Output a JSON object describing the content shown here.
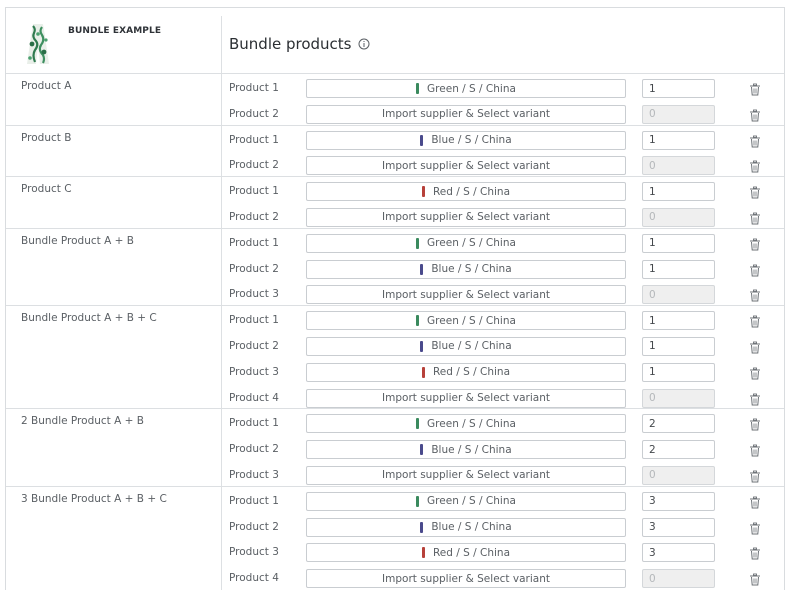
{
  "header": {
    "bundle_example": "BUNDLE EXAMPLE",
    "title": "Bundle products",
    "info_icon": "info-icon"
  },
  "colors": {
    "green": "#3a8a5e",
    "blue": "#4a4a8c",
    "red": "#b7413a",
    "border": "#c9cdd1"
  },
  "bundles": [
    {
      "name": "Product A",
      "rows": [
        {
          "label": "Product 1",
          "variant": "Green / S / China",
          "swatch": "green",
          "qty": "1",
          "disabled": false
        },
        {
          "label": "Product 2",
          "variant": "Import supplier & Select variant",
          "swatch": "",
          "qty": "0",
          "disabled": true
        }
      ]
    },
    {
      "name": "Product B",
      "rows": [
        {
          "label": "Product 1",
          "variant": "Blue / S / China",
          "swatch": "blue",
          "qty": "1",
          "disabled": false
        },
        {
          "label": "Product 2",
          "variant": "Import supplier & Select variant",
          "swatch": "",
          "qty": "0",
          "disabled": true
        }
      ]
    },
    {
      "name": "Product C",
      "rows": [
        {
          "label": "Product 1",
          "variant": "Red / S / China",
          "swatch": "red",
          "qty": "1",
          "disabled": false
        },
        {
          "label": "Product 2",
          "variant": "Import supplier & Select variant",
          "swatch": "",
          "qty": "0",
          "disabled": true
        }
      ]
    },
    {
      "name": "Bundle Product A + B",
      "rows": [
        {
          "label": "Product 1",
          "variant": "Green / S / China",
          "swatch": "green",
          "qty": "1",
          "disabled": false
        },
        {
          "label": "Product 2",
          "variant": "Blue / S / China",
          "swatch": "blue",
          "qty": "1",
          "disabled": false
        },
        {
          "label": "Product 3",
          "variant": "Import supplier & Select variant",
          "swatch": "",
          "qty": "0",
          "disabled": true
        }
      ]
    },
    {
      "name": "Bundle Product A + B + C",
      "rows": [
        {
          "label": "Product 1",
          "variant": "Green / S / China",
          "swatch": "green",
          "qty": "1",
          "disabled": false
        },
        {
          "label": "Product 2",
          "variant": "Blue / S / China",
          "swatch": "blue",
          "qty": "1",
          "disabled": false
        },
        {
          "label": "Product 3",
          "variant": "Red / S / China",
          "swatch": "red",
          "qty": "1",
          "disabled": false
        },
        {
          "label": "Product 4",
          "variant": "Import supplier & Select variant",
          "swatch": "",
          "qty": "0",
          "disabled": true
        }
      ]
    },
    {
      "name": "2 Bundle Product A + B",
      "rows": [
        {
          "label": "Product 1",
          "variant": "Green / S / China",
          "swatch": "green",
          "qty": "2",
          "disabled": false
        },
        {
          "label": "Product 2",
          "variant": "Blue / S / China",
          "swatch": "blue",
          "qty": "2",
          "disabled": false
        },
        {
          "label": "Product 3",
          "variant": "Import supplier & Select variant",
          "swatch": "",
          "qty": "0",
          "disabled": true
        }
      ]
    },
    {
      "name": "3 Bundle Product A + B + C",
      "rows": [
        {
          "label": "Product 1",
          "variant": "Green / S / China",
          "swatch": "green",
          "qty": "3",
          "disabled": false
        },
        {
          "label": "Product 2",
          "variant": "Blue / S / China",
          "swatch": "blue",
          "qty": "3",
          "disabled": false
        },
        {
          "label": "Product 3",
          "variant": "Red / S / China",
          "swatch": "red",
          "qty": "3",
          "disabled": false
        },
        {
          "label": "Product 4",
          "variant": "Import supplier & Select variant",
          "swatch": "",
          "qty": "0",
          "disabled": true
        }
      ]
    }
  ]
}
